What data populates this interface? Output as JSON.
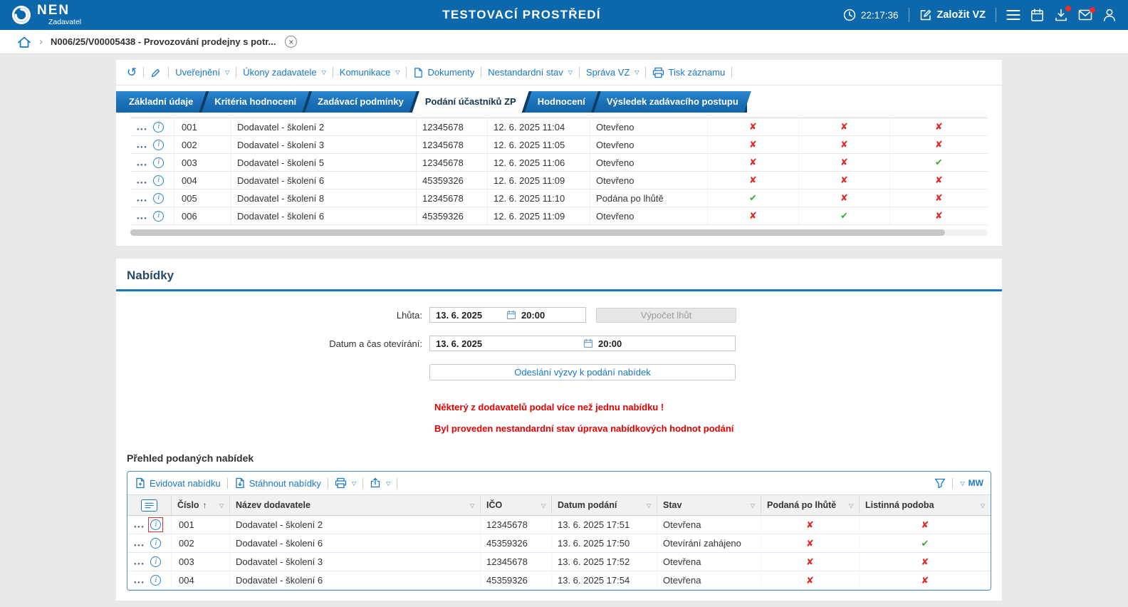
{
  "topbar": {
    "brand": "NEN",
    "brand_sub": "Zadavatel",
    "env_title": "TESTOVACÍ PROSTŘEDÍ",
    "clock": "22:17:36",
    "create_vz_label": "Založit VZ"
  },
  "breadcrumb": {
    "item": "N006/25/V00005438 - Provozování prodejny s potr..."
  },
  "toolbar": {
    "items": [
      {
        "label": "Uveřejnění"
      },
      {
        "label": "Úkony zadavatele"
      },
      {
        "label": "Komunikace"
      },
      {
        "label": "Dokumenty"
      },
      {
        "label": "Nestandardní stav"
      },
      {
        "label": "Správa VZ"
      },
      {
        "label": "Tisk záznamu"
      }
    ]
  },
  "tabs": [
    {
      "label": "Základní údaje",
      "active": false
    },
    {
      "label": "Kritéria hodnocení",
      "active": false
    },
    {
      "label": "Zadávací podmínky",
      "active": false
    },
    {
      "label": "Podání účastníků ZP",
      "active": true
    },
    {
      "label": "Hodnocení",
      "active": false
    },
    {
      "label": "Výsledek zadávacího postupu",
      "active": false
    }
  ],
  "glyphs": {
    "x": "✘",
    "ok": "✔",
    "dropdown": "▽",
    "sort_asc": "↑"
  },
  "participants": {
    "rows": [
      {
        "num": "001",
        "name": "Dodavatel - školení 2",
        "ico": "12345678",
        "date": "12. 6. 2025 11:04",
        "status": "Otevřeno",
        "m1": "x",
        "m2": "x",
        "m3": "x"
      },
      {
        "num": "002",
        "name": "Dodavatel - školení 3",
        "ico": "12345678",
        "date": "12. 6. 2025 11:05",
        "status": "Otevřeno",
        "m1": "x",
        "m2": "x",
        "m3": "x"
      },
      {
        "num": "003",
        "name": "Dodavatel - školení 5",
        "ico": "12345678",
        "date": "12. 6. 2025 11:06",
        "status": "Otevřeno",
        "m1": "x",
        "m2": "x",
        "m3": "ok"
      },
      {
        "num": "004",
        "name": "Dodavatel - školení 6",
        "ico": "45359326",
        "date": "12. 6. 2025 11:09",
        "status": "Otevřeno",
        "m1": "x",
        "m2": "x",
        "m3": "x"
      },
      {
        "num": "005",
        "name": "Dodavatel - školení 8",
        "ico": "12345678",
        "date": "12. 6. 2025 11:10",
        "status": "Podána po lhůtě",
        "m1": "ok",
        "m2": "x",
        "m3": "x"
      },
      {
        "num": "006",
        "name": "Dodavatel - školení 6",
        "ico": "45359326",
        "date": "12. 6. 2025 11:09",
        "status": "Otevřeno",
        "m1": "x",
        "m2": "ok",
        "m3": "x"
      }
    ]
  },
  "nabidky": {
    "title": "Nabídky",
    "lhuta_label": "Lhůta:",
    "lhuta_date": "13. 6. 2025",
    "lhuta_time": "20:00",
    "vypocet_button": "Výpočet lhůt",
    "datum_label": "Datum a čas otevírání:",
    "datum_date": "13. 6. 2025",
    "datum_time": "20:00",
    "odeslani_button": "Odeslání výzvy k podání nabídek",
    "warning1": "Některý z dodavatelů podal více než jednu nabídku !",
    "warning2": "Byl proveden nestandardní stav úprava nabídkových hodnot podání"
  },
  "prehled": {
    "title": "Přehled podaných nabídek",
    "toolbar": {
      "evidovat": "Evidovat nabídku",
      "stahnout": "Stáhnout nabídky",
      "mw": "MW"
    },
    "headers": [
      "Číslo",
      "Název dodavatele",
      "IČO",
      "Datum podání",
      "Stav",
      "Podaná po lhůtě",
      "Listinná podoba"
    ],
    "rows": [
      {
        "num": "001",
        "name": "Dodavatel - školení 2",
        "ico": "12345678",
        "date": "13. 6. 2025 17:51",
        "status": "Otevřena",
        "late": "x",
        "paper": "x",
        "highlight": true
      },
      {
        "num": "002",
        "name": "Dodavatel - školení 6",
        "ico": "45359326",
        "date": "13. 6. 2025 17:50",
        "status": "Otevírání zahájeno",
        "late": "x",
        "paper": "ok"
      },
      {
        "num": "003",
        "name": "Dodavatel - školení 3",
        "ico": "12345678",
        "date": "13. 6. 2025 17:52",
        "status": "Otevřena",
        "late": "x",
        "paper": "x"
      },
      {
        "num": "004",
        "name": "Dodavatel - školení 6",
        "ico": "45359326",
        "date": "13. 6. 2025 17:54",
        "status": "Otevřena",
        "late": "x",
        "paper": "x"
      }
    ]
  }
}
